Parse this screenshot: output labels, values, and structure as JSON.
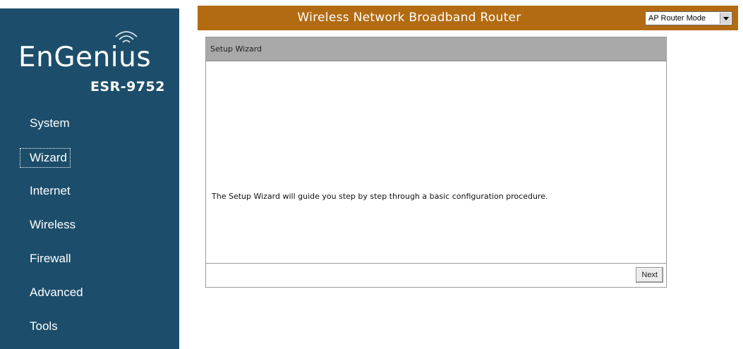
{
  "sidebar": {
    "brand": "EnGenius",
    "model": "ESR-9752",
    "items": [
      {
        "label": "System"
      },
      {
        "label": "Wizard"
      },
      {
        "label": "Internet"
      },
      {
        "label": "Wireless"
      },
      {
        "label": "Firewall"
      },
      {
        "label": "Advanced"
      },
      {
        "label": "Tools"
      }
    ],
    "active_item": "Wizard"
  },
  "header": {
    "title": "Wireless Network Broadband Router",
    "mode_select": {
      "selected": "AP Router Mode"
    }
  },
  "wizard": {
    "title": "Setup Wizard",
    "description": "The Setup Wizard will guide you step by step through a basic configuration procedure.",
    "next_label": "Next"
  },
  "colors": {
    "sidebar_bg": "#1c4e6b",
    "header_bg": "#b36b12",
    "panel_header_bg": "#a9a9a9"
  },
  "icons": {
    "logo_wifi": "wifi-icon",
    "dropdown_arrow": "chevron-down-icon"
  }
}
